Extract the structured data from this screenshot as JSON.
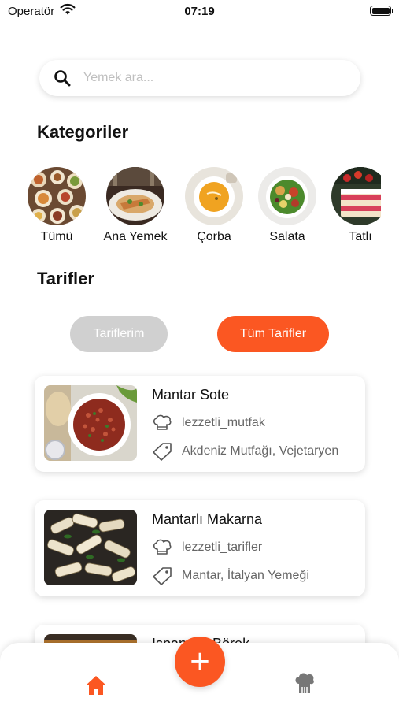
{
  "status_bar": {
    "carrier": "Operatör",
    "time": "07:19"
  },
  "search": {
    "placeholder": "Yemek ara..."
  },
  "categories_title": "Kategoriler",
  "categories": [
    {
      "label": "Tümü",
      "icon": "mixed-dishes-photo"
    },
    {
      "label": "Ana Yemek",
      "icon": "main-dish-photo"
    },
    {
      "label": "Çorba",
      "icon": "soup-photo"
    },
    {
      "label": "Salata",
      "icon": "salad-photo"
    },
    {
      "label": "Tatlı",
      "icon": "cake-photo"
    }
  ],
  "recipes_title": "Tarifler",
  "filter": {
    "mine_label": "Tariflerim",
    "all_label": "Tüm Tarifler",
    "active": "Tüm Tarifler"
  },
  "recipes": [
    {
      "title": "Mantar Sote",
      "author": "lezzetli_mutfak",
      "tags": "Akdeniz Mutfağı, Vejetaryen"
    },
    {
      "title": "Mantarlı Makarna",
      "author": "lezzetli_tarifler",
      "tags": "Mantar, İtalyan Yemeği"
    },
    {
      "title": "Ispanaklı Börek",
      "author": "",
      "tags": ""
    }
  ],
  "tab_bar": {
    "add_label": "+",
    "home_icon": "home-icon",
    "chef_icon": "chef-hat-icon"
  },
  "colors": {
    "accent": "#fb5722",
    "inactive_toggle": "#d0d0d0",
    "text_muted": "#666666"
  }
}
